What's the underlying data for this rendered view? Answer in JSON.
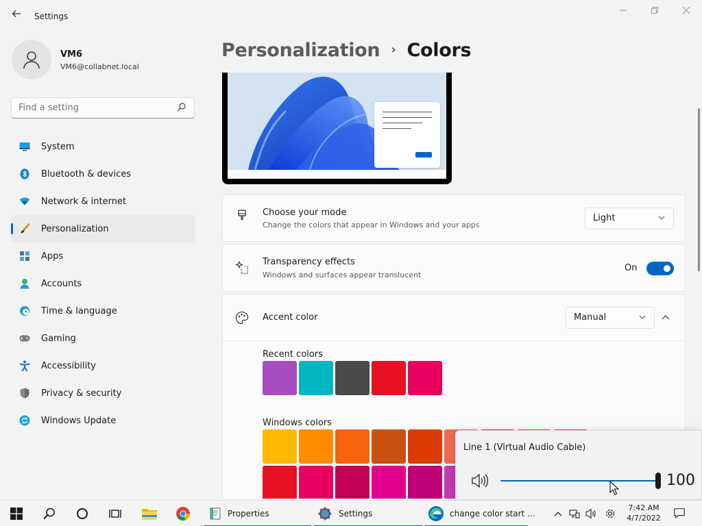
{
  "window": {
    "title": "Settings",
    "back_label": "←",
    "minimize": "—",
    "maximize": "❐",
    "close": "✕"
  },
  "user": {
    "name": "VM6",
    "email": "VM6@collabnet.local"
  },
  "search": {
    "placeholder": "Find a setting"
  },
  "sidebar": {
    "items": [
      {
        "label": "System",
        "icon": "system-icon"
      },
      {
        "label": "Bluetooth & devices",
        "icon": "bluetooth-icon"
      },
      {
        "label": "Network & internet",
        "icon": "wifi-icon"
      },
      {
        "label": "Personalization",
        "icon": "brush-icon",
        "active": true
      },
      {
        "label": "Apps",
        "icon": "apps-icon"
      },
      {
        "label": "Accounts",
        "icon": "accounts-icon"
      },
      {
        "label": "Time & language",
        "icon": "clock-globe-icon"
      },
      {
        "label": "Gaming",
        "icon": "gamepad-icon"
      },
      {
        "label": "Accessibility",
        "icon": "accessibility-icon"
      },
      {
        "label": "Privacy & security",
        "icon": "shield-icon"
      },
      {
        "label": "Windows Update",
        "icon": "update-icon"
      }
    ]
  },
  "breadcrumb": {
    "parent": "Personalization",
    "separator": "›",
    "current": "Colors"
  },
  "mode": {
    "title": "Choose your mode",
    "subtitle": "Change the colors that appear in Windows and your apps",
    "value": "Light"
  },
  "transparency": {
    "title": "Transparency effects",
    "subtitle": "Windows and surfaces appear translucent",
    "state": "On"
  },
  "accent": {
    "title": "Accent color",
    "value": "Manual",
    "recent_label": "Recent colors",
    "recent_colors": [
      "#a84bbf",
      "#00b7c3",
      "#4c4a48",
      "#e81123",
      "#ea005e"
    ],
    "windows_label": "Windows colors",
    "windows_colors_row1": [
      "#ffb900",
      "#ff8c00",
      "#f7630c",
      "#ca5010",
      "#da3b01",
      "#ef6950",
      "#d13438",
      "#ff4343",
      "#e74856"
    ],
    "windows_colors_row2": [
      "#e81123",
      "#ea005e",
      "#c30052",
      "#e3008c",
      "#bf0077",
      "#c239b3"
    ]
  },
  "volume_flyout": {
    "device": "Line 1 (Virtual Audio Cable)",
    "level": 100,
    "level_fraction": 1.0
  },
  "taskbar": {
    "apps": [
      {
        "label": "Properties",
        "icon": "properties-icon"
      },
      {
        "label": "Settings",
        "icon": "settings-gear-icon"
      },
      {
        "label": "change color start ...",
        "icon": "edge-icon"
      }
    ],
    "time": "7:42 AM",
    "date": "4/7/2022",
    "tray_chevron": "^"
  },
  "colors": {
    "accent": "#0067c0"
  }
}
